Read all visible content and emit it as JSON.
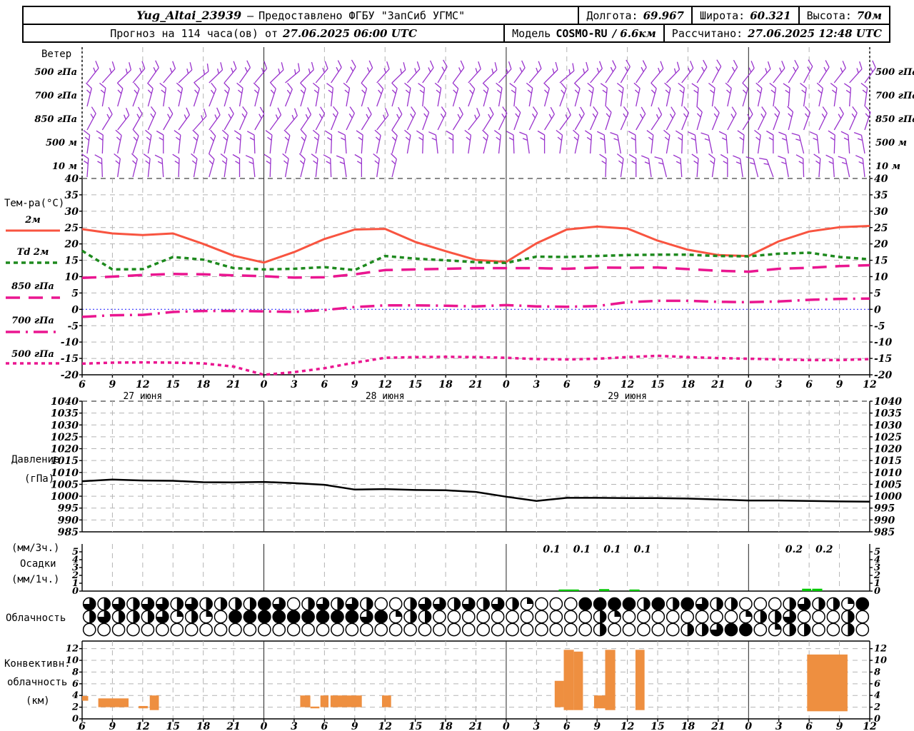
{
  "header": {
    "row1": {
      "station": "Yug_Altai_23939",
      "dash": "—",
      "provider": "Предоставлено ФГБУ \"ЗапСиб УГМС\"",
      "lon_label": "Долгота:",
      "lon": "69.967",
      "lat_label": "Широта:",
      "lat": "60.321",
      "alt_label": "Высота:",
      "alt": "70м"
    },
    "row2": {
      "forecast_label": "Прогноз на 114 часа(ов) от",
      "run_time": "27.06.2025 06:00 UTC",
      "model_label": "Модель",
      "model_name": "COSMO-RU",
      "model_res": "/ 6.6км",
      "calc_label": "Рассчитано:",
      "calc_time": "27.06.2025 12:48 UTC"
    }
  },
  "labels": {
    "wind_title": "Ветер",
    "temp_title": "Тем-ра(°C)",
    "pressure_1": "Давление",
    "pressure_2": "(гПа)",
    "precip_1": "(мм/3ч.)",
    "precip_2": "Осадки",
    "precip_3": "(мм/1ч.)",
    "cloud": "Облачность",
    "conv_1": "Конвективн.",
    "conv_2": "облачность",
    "conv_3": "(км)"
  },
  "colors": {
    "wind_barb": "#9932cc",
    "temp_2m": "#f85440",
    "dewpoint": "#1e8a1e",
    "magenta": "#ea1690",
    "zero_line": "#3333ff",
    "pressure": "#000000",
    "precip_bar": "#00c800",
    "conv_bar": "#ee8f40",
    "grid": "#b4b4b4",
    "grid_dark": "#666666"
  },
  "time_axis": {
    "hours_span": 78,
    "step_hours": 3,
    "hour_labels": [
      "6",
      "9",
      "12",
      "15",
      "18",
      "21",
      "0",
      "3",
      "6",
      "9",
      "12",
      "15",
      "18",
      "21",
      "0",
      "3",
      "6",
      "9",
      "12",
      "15",
      "18",
      "21",
      "0",
      "3",
      "6",
      "9",
      "12"
    ],
    "date_labels": [
      {
        "label": "27 июня",
        "tick_index": 2
      },
      {
        "label": "28 июня",
        "tick_index": 10
      },
      {
        "label": "29 июня",
        "tick_index": 18
      }
    ],
    "midnight_tick_indices": [
      6,
      14,
      22
    ]
  },
  "chart_data": [
    {
      "type": "wind-barbs",
      "id": "wind",
      "title": "Ветер",
      "levels": [
        {
          "label": "500 гПа",
          "dirs": [
            38,
            42,
            46,
            40,
            35,
            40,
            46,
            52,
            46,
            40,
            35,
            40,
            46,
            50,
            45,
            40,
            34,
            30,
            36,
            42,
            46,
            42,
            36,
            30,
            36,
            42,
            46,
            42,
            36,
            40,
            45,
            50,
            45,
            40,
            34,
            30,
            34,
            40,
            44,
            38,
            32,
            28,
            32,
            38,
            42,
            38,
            32,
            28,
            33,
            38,
            42,
            36
          ]
        },
        {
          "label": "700 гПа",
          "dirs": [
            14,
            10,
            16,
            20,
            15,
            8,
            12,
            18,
            22,
            16,
            10,
            14,
            18,
            22,
            16,
            10,
            6,
            10,
            16,
            20,
            16,
            10,
            6,
            10,
            16,
            20,
            15,
            10,
            6,
            10,
            15,
            20,
            15,
            10,
            5,
            8,
            12,
            16,
            12,
            8,
            4,
            8,
            12,
            16,
            12,
            8,
            4,
            8,
            12,
            8,
            4,
            8
          ]
        },
        {
          "label": "850 гПа",
          "dirs": [
            28,
            32,
            38,
            30,
            24,
            30,
            36,
            42,
            36,
            30,
            24,
            30,
            36,
            40,
            34,
            28,
            22,
            26,
            32,
            38,
            32,
            26,
            20,
            26,
            32,
            38,
            32,
            26,
            20,
            26,
            32,
            36,
            30,
            24,
            18,
            24,
            30,
            34,
            28,
            22,
            16,
            22,
            28,
            32,
            26,
            20,
            14,
            20,
            26,
            30,
            24,
            18
          ]
        },
        {
          "label": "500 м",
          "dirs": [
            8,
            2,
            12,
            18,
            10,
            0,
            6,
            14,
            20,
            12,
            4,
            -2,
            6,
            14,
            18,
            10,
            2,
            -4,
            4,
            12,
            16,
            10,
            2,
            -6,
            0,
            8,
            14,
            6,
            -2,
            -8,
            0,
            8,
            12,
            4,
            -4,
            -10,
            -2,
            6,
            10,
            2,
            -6,
            -12,
            -4,
            4,
            8,
            0,
            -8,
            -14,
            -6,
            2,
            -4,
            -10
          ]
        },
        {
          "label": "10  м",
          "dirs": [
            4,
            -2,
            8,
            14,
            6,
            -4,
            2,
            10,
            16,
            8,
            0,
            -6,
            2,
            10,
            14,
            6,
            -2,
            -8,
            0,
            8,
            14,
            null,
            null,
            null,
            null,
            null,
            null,
            null,
            null,
            null,
            null,
            null,
            null,
            null,
            2,
            8,
            0,
            -8,
            -14,
            -4,
            4,
            8,
            0,
            -8,
            -14,
            -20,
            -10,
            -2,
            4,
            -4,
            -12,
            -6
          ]
        }
      ]
    },
    {
      "type": "line",
      "id": "temperature",
      "title": "Тем-ра(°C)",
      "ylim": [
        -20,
        40
      ],
      "ystep": 5,
      "zero_line": true,
      "series": [
        {
          "name": "2м",
          "color": "#f85440",
          "dash": "",
          "width": 3,
          "values": [
            24.5,
            23.2,
            22.7,
            23.2,
            20.0,
            16.4,
            14.3,
            17.5,
            21.5,
            24.4,
            24.6,
            20.6,
            17.8,
            15.1,
            14.5,
            20.2,
            24.4,
            25.3,
            24.7,
            21.0,
            18.2,
            16.6,
            16.3,
            20.8,
            23.8,
            25.1,
            25.5
          ]
        },
        {
          "name": "Td 2м",
          "color": "#1e8a1e",
          "dash": "6 5",
          "width": 3.5,
          "values": [
            17.9,
            12.2,
            12.3,
            16.0,
            15.2,
            12.6,
            12.2,
            12.4,
            12.9,
            12.0,
            16.3,
            15.5,
            15.0,
            14.4,
            14.2,
            16.1,
            16.0,
            16.3,
            16.6,
            16.7,
            16.7,
            16.3,
            16.2,
            17.0,
            17.3,
            16.0,
            15.3
          ]
        },
        {
          "name": "850 гПа",
          "color": "#ea1690",
          "dash": "20 12",
          "width": 3.5,
          "values": [
            9.6,
            10.0,
            10.5,
            10.8,
            10.7,
            10.4,
            10.1,
            9.7,
            9.8,
            10.7,
            12.0,
            12.2,
            12.4,
            12.6,
            12.6,
            12.6,
            12.4,
            12.8,
            12.7,
            12.8,
            12.3,
            11.8,
            11.5,
            12.4,
            12.7,
            13.2,
            13.5
          ]
        },
        {
          "name": "700 гПа",
          "color": "#ea1690",
          "dash": "20 8 3 8",
          "width": 3.5,
          "values": [
            -2.3,
            -1.8,
            -1.7,
            -0.8,
            -0.5,
            -0.5,
            -0.6,
            -0.8,
            -0.2,
            0.7,
            1.2,
            1.2,
            1.1,
            0.9,
            1.3,
            0.9,
            0.8,
            1.0,
            2.2,
            2.6,
            2.6,
            2.3,
            2.2,
            2.4,
            2.9,
            3.2,
            3.3
          ]
        },
        {
          "name": "500 гПа",
          "color": "#ea1690",
          "dash": "5 5",
          "width": 3.5,
          "values": [
            -16.6,
            -16.3,
            -16.2,
            -16.3,
            -16.5,
            -17.5,
            -20.0,
            -19.2,
            -18.0,
            -16.3,
            -14.8,
            -14.6,
            -14.5,
            -14.6,
            -14.8,
            -15.2,
            -15.3,
            -15.1,
            -14.6,
            -14.2,
            -14.6,
            -14.9,
            -15.1,
            -15.3,
            -15.5,
            -15.5,
            -15.2
          ]
        }
      ]
    },
    {
      "type": "line",
      "id": "pressure",
      "title": "Давление (гПа)",
      "ylim": [
        985,
        1040
      ],
      "ystep": 5,
      "series": [
        {
          "name": "Давление",
          "color": "#000000",
          "dash": "",
          "width": 2.5,
          "values": [
            1006.3,
            1007.0,
            1006.6,
            1006.5,
            1005.9,
            1005.8,
            1006.0,
            1005.5,
            1004.8,
            1002.8,
            1003.0,
            1002.6,
            1002.5,
            1001.8,
            999.8,
            998.0,
            999.3,
            999.3,
            999.2,
            999.2,
            999.0,
            998.6,
            998.2,
            998.2,
            998.0,
            997.8,
            997.7
          ]
        }
      ]
    },
    {
      "type": "bar",
      "id": "precipitation",
      "title": "Осадки (мм/3ч.) (мм/1ч.)",
      "ylim": [
        0,
        6
      ],
      "ystep": 1,
      "ymax_label": 5,
      "labels_3h": [
        {
          "center_hour": 46.5,
          "value": "0.1"
        },
        {
          "center_hour": 49.5,
          "value": "0.1"
        },
        {
          "center_hour": 52.5,
          "value": "0.1"
        },
        {
          "center_hour": 55.5,
          "value": "0.1"
        },
        {
          "center_hour": 70.5,
          "value": "0.2"
        },
        {
          "center_hour": 73.5,
          "value": "0.2"
        }
      ],
      "bars_1h": [
        {
          "h0": 47.2,
          "h1": 49.2,
          "value": 0.2
        },
        {
          "h0": 51.2,
          "h1": 52.2,
          "value": 0.25
        },
        {
          "h0": 54.2,
          "h1": 55.2,
          "value": 0.2
        },
        {
          "h0": 71.3,
          "h1": 72.2,
          "value": 0.3
        },
        {
          "h0": 72.3,
          "h1": 73.3,
          "value": 0.3
        }
      ]
    },
    {
      "type": "cloud-symbols",
      "id": "cloudiness",
      "title": "Облачность",
      "rows_eighths": [
        [
          6,
          4,
          6,
          4,
          6,
          6,
          4,
          6,
          4,
          4,
          4,
          4,
          8,
          6,
          0,
          4,
          6,
          4,
          6,
          4,
          0,
          0,
          4,
          6,
          6,
          4,
          6,
          4,
          6,
          4,
          2,
          0,
          0,
          0,
          8,
          8,
          8,
          8,
          4,
          8,
          4,
          8,
          6,
          4,
          4,
          0,
          0,
          0,
          4,
          6,
          4,
          4,
          2,
          8
        ],
        [
          4,
          6,
          4,
          4,
          4,
          6,
          2,
          4,
          2,
          0,
          8,
          8,
          8,
          8,
          8,
          8,
          8,
          8,
          8,
          6,
          8,
          2,
          4,
          4,
          0,
          0,
          0,
          0,
          0,
          0,
          0,
          0,
          0,
          0,
          0,
          4,
          2,
          0,
          0,
          0,
          0,
          0,
          0,
          0,
          0,
          2,
          4,
          4,
          6,
          0,
          0,
          0,
          4,
          0
        ],
        [
          0,
          0,
          0,
          0,
          0,
          0,
          0,
          0,
          0,
          0,
          0,
          0,
          0,
          0,
          0,
          0,
          0,
          0,
          0,
          0,
          0,
          0,
          0,
          0,
          0,
          0,
          0,
          0,
          0,
          0,
          0,
          0,
          0,
          0,
          0,
          4,
          0,
          0,
          0,
          0,
          0,
          4,
          4,
          6,
          8,
          8,
          0,
          2,
          4,
          4,
          0,
          0,
          4,
          0
        ]
      ]
    },
    {
      "type": "bar",
      "id": "convective",
      "title": "Конвективн. облачность (км)",
      "ylim": [
        0,
        13.3
      ],
      "ystep": 2,
      "bars": [
        {
          "h0": 0,
          "h1": 0.6,
          "base": 3.1,
          "top": 3.9
        },
        {
          "h0": 1.6,
          "h1": 4.6,
          "base": 2.0,
          "top": 3.5
        },
        {
          "h0": 5.6,
          "h1": 6.5,
          "base": 1.8,
          "top": 2.2
        },
        {
          "h0": 6.7,
          "h1": 7.6,
          "base": 1.5,
          "top": 4.0
        },
        {
          "h0": 21.6,
          "h1": 22.6,
          "base": 2.0,
          "top": 4.0
        },
        {
          "h0": 22.6,
          "h1": 23.5,
          "base": 1.8,
          "top": 2.1
        },
        {
          "h0": 23.6,
          "h1": 24.4,
          "base": 2.0,
          "top": 4.0
        },
        {
          "h0": 24.6,
          "h1": 27.7,
          "base": 2.0,
          "top": 4.0
        },
        {
          "h0": 29.7,
          "h1": 30.6,
          "base": 2.0,
          "top": 4.0
        },
        {
          "h0": 46.8,
          "h1": 47.7,
          "base": 2.0,
          "top": 6.5
        },
        {
          "h0": 47.7,
          "h1": 48.7,
          "base": 1.5,
          "top": 11.8
        },
        {
          "h0": 48.7,
          "h1": 49.6,
          "base": 1.5,
          "top": 11.5
        },
        {
          "h0": 50.7,
          "h1": 51.8,
          "base": 1.8,
          "top": 4.0
        },
        {
          "h0": 51.8,
          "h1": 52.8,
          "base": 1.5,
          "top": 11.8
        },
        {
          "h0": 54.8,
          "h1": 55.7,
          "base": 1.5,
          "top": 11.8
        },
        {
          "h0": 71.8,
          "h1": 75.8,
          "base": 1.3,
          "top": 11.0
        }
      ]
    }
  ]
}
